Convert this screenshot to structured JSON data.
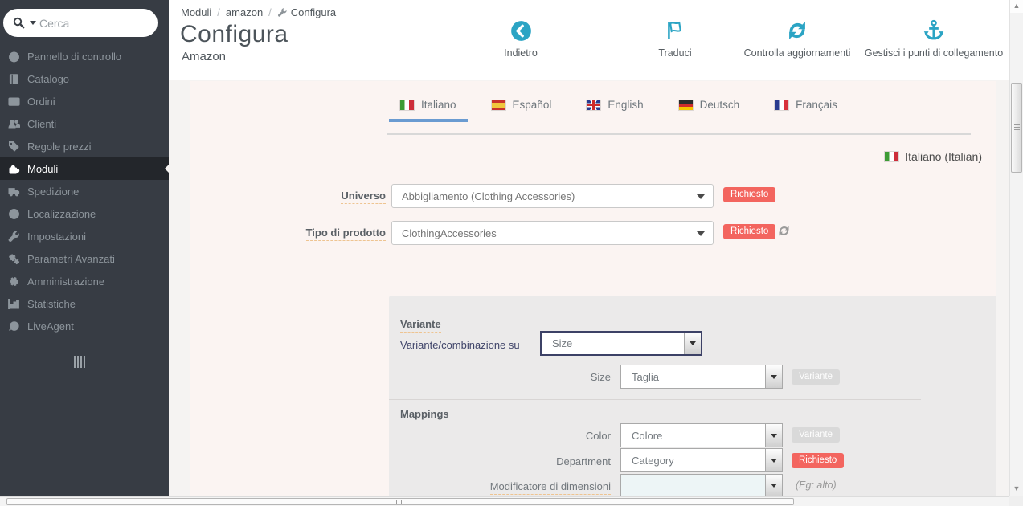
{
  "colors": {
    "accent_teal": "#2ba4c4",
    "badge_red": "#f3655f",
    "tab_underline_blue": "#6a9bd1",
    "sidebar_bg": "#373c44",
    "panel_pink": "#fbf4f2"
  },
  "sidebar": {
    "search_placeholder": "Cerca",
    "items": [
      {
        "label": "Pannello di controllo",
        "icon": "dashboard-icon"
      },
      {
        "label": "Catalogo",
        "icon": "book-icon"
      },
      {
        "label": "Ordini",
        "icon": "orders-icon"
      },
      {
        "label": "Clienti",
        "icon": "customers-icon"
      },
      {
        "label": "Regole prezzi",
        "icon": "price-tag-icon"
      },
      {
        "label": "Moduli",
        "icon": "puzzle-icon",
        "active": true
      },
      {
        "label": "Spedizione",
        "icon": "truck-icon"
      },
      {
        "label": "Localizzazione",
        "icon": "globe-icon"
      },
      {
        "label": "Impostazioni",
        "icon": "wrench-icon"
      },
      {
        "label": "Parametri Avanzati",
        "icon": "cogs-icon"
      },
      {
        "label": "Amministrazione",
        "icon": "gear-icon"
      },
      {
        "label": "Statistiche",
        "icon": "stats-icon"
      },
      {
        "label": "LiveAgent",
        "icon": "liveagent-icon"
      }
    ]
  },
  "header": {
    "breadcrumb": {
      "item1": "Moduli",
      "item2": "amazon",
      "item3": "Configura",
      "separator": "/"
    },
    "title": "Configura",
    "subtitle": "Amazon",
    "actions": [
      {
        "label": "Indietro",
        "icon": "back-icon"
      },
      {
        "label": "Traduci",
        "icon": "flag-icon"
      },
      {
        "label": "Controlla aggiornamenti",
        "icon": "refresh-icon"
      },
      {
        "label": "Gestisci i punti di collegamento",
        "icon": "anchor-icon"
      }
    ]
  },
  "tabs": [
    {
      "label": "Italiano",
      "flag": "italy-flag-icon",
      "active": true
    },
    {
      "label": "Español",
      "flag": "spain-flag-icon",
      "active": false
    },
    {
      "label": "English",
      "flag": "uk-flag-icon",
      "active": false
    },
    {
      "label": "Deutsch",
      "flag": "germany-flag-icon",
      "active": false
    },
    {
      "label": "Français",
      "flag": "france-flag-icon",
      "active": false
    }
  ],
  "panel": {
    "language_indicator": "Italiano (Italian)",
    "universo": {
      "label": "Universo",
      "value": "Abbigliamento (Clothing Accessories)",
      "badge": "Richiesto"
    },
    "tipo_prodotto": {
      "label": "Tipo di prodotto",
      "value": "ClothingAccessories",
      "badge": "Richiesto"
    },
    "variante": {
      "heading": "Variante",
      "combo_label": "Variante/combinazione su",
      "combo_value": "Size",
      "size_label": "Size",
      "size_value": "Taglia",
      "size_badge": "Variante"
    },
    "mappings": {
      "heading": "Mappings",
      "color_label": "Color",
      "color_value": "Colore",
      "color_badge": "Variante",
      "department_label": "Department",
      "department_value": "Category",
      "department_badge": "Richiesto",
      "modifier_label": "Modificatore di dimensioni",
      "modifier_value": "",
      "modifier_hint": "(Eg: alto)"
    }
  }
}
